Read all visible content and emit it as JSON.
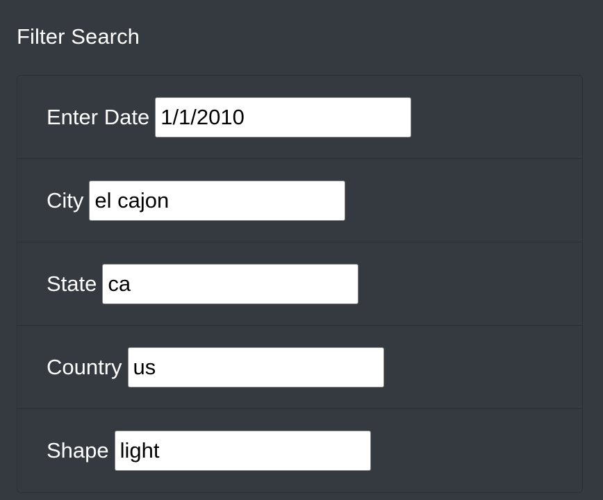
{
  "panel": {
    "title": "Filter Search"
  },
  "filters": [
    {
      "label": "Enter Date",
      "value": "1/1/2010"
    },
    {
      "label": "City",
      "value": "el cajon"
    },
    {
      "label": "State",
      "value": "ca"
    },
    {
      "label": "Country",
      "value": "us"
    },
    {
      "label": "Shape",
      "value": "light"
    }
  ],
  "colors": {
    "background": "#343a40",
    "text": "#ffffff",
    "input_background": "#ffffff",
    "input_border": "#858585"
  }
}
